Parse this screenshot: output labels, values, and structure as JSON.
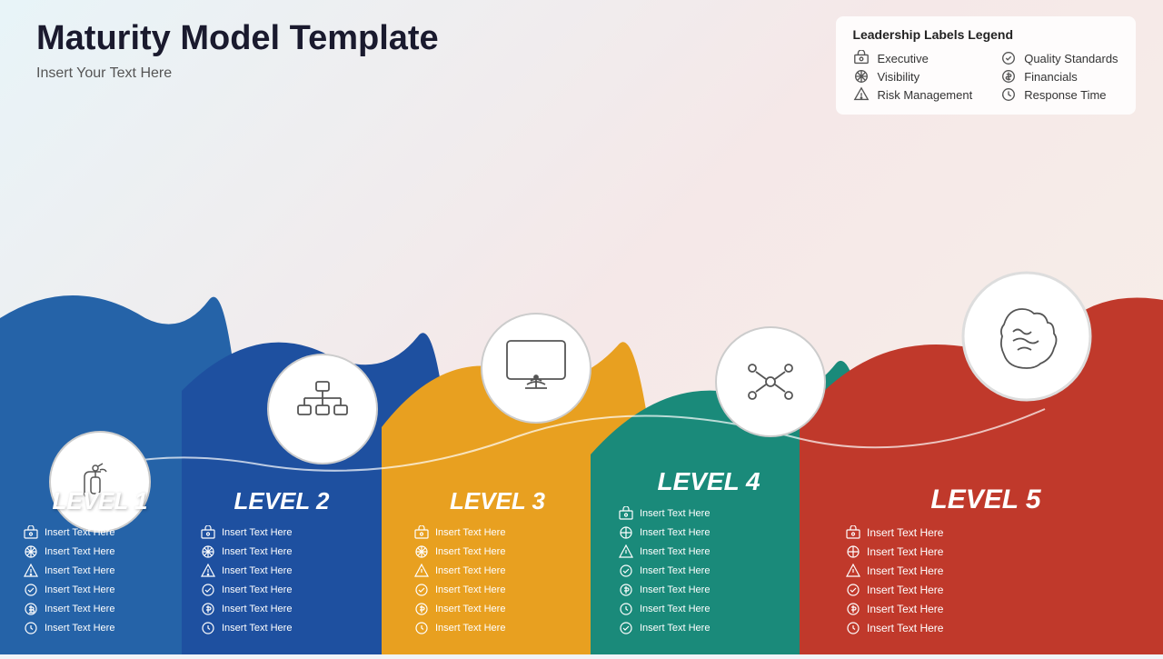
{
  "header": {
    "title": "Maturity Model Template",
    "subtitle": "Insert Your Text Here"
  },
  "legend": {
    "title": "Leadership Labels Legend",
    "left_items": [
      {
        "icon": "executive-icon",
        "label": "Executive"
      },
      {
        "icon": "visibility-icon",
        "label": "Visibility"
      },
      {
        "icon": "risk-icon",
        "label": "Risk Management"
      }
    ],
    "right_items": [
      {
        "icon": "quality-icon",
        "label": "Quality Standards"
      },
      {
        "icon": "financials-icon",
        "label": "Financials"
      },
      {
        "icon": "response-icon",
        "label": "Response Time"
      }
    ]
  },
  "levels": [
    {
      "id": "level1",
      "label": "LEVEL 1",
      "color": "#2563a8",
      "items": [
        "Insert Text Here",
        "Insert Text Here",
        "Insert Text Here",
        "Insert Text Here",
        "Insert Text Here",
        "Insert Text Here"
      ]
    },
    {
      "id": "level2",
      "label": "LEVEL 2",
      "color": "#2563a8",
      "items": [
        "Insert Text Here",
        "Insert Text Here",
        "Insert Text Here",
        "Insert Text Here",
        "Insert Text Here",
        "Insert Text Here"
      ]
    },
    {
      "id": "level3",
      "label": "LEVEL 3",
      "color": "#e8a020",
      "items": [
        "Insert Text Here",
        "Insert Text Here",
        "Insert Text Here",
        "Insert Text Here",
        "Insert Text Here",
        "Insert Text Here"
      ]
    },
    {
      "id": "level4",
      "label": "LEVEL 4",
      "color": "#1a8a7a",
      "items": [
        "Insert Text Here",
        "Insert Text Here",
        "Insert Text Here",
        "Insert Text Here",
        "Insert Text Here",
        "Insert Text Here",
        "Insert Text Here"
      ]
    },
    {
      "id": "level5",
      "label": "LEVEL 5",
      "color": "#c0392b",
      "items": [
        "Insert Text Here",
        "Insert Text Here",
        "Insert Text Here",
        "Insert Text Here",
        "Insert Text Here",
        "Insert Text Here"
      ]
    }
  ],
  "icons": {
    "executive": "🔲",
    "visibility": "⚙",
    "risk": "🔼",
    "quality": "⭕",
    "financials": "💲",
    "response": "🕐"
  }
}
